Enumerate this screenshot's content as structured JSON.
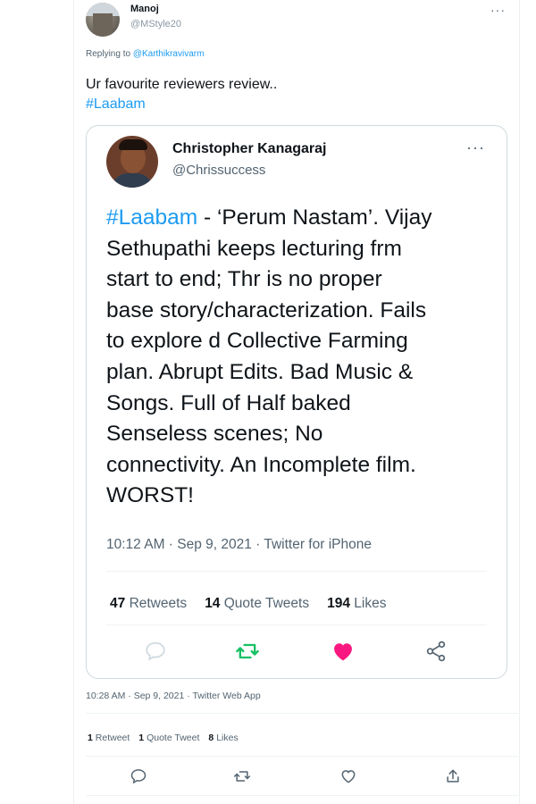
{
  "outer_tweet": {
    "author_name": "Manoj",
    "author_handle": "@MStyle20",
    "more_icon": "more-dots-icon",
    "replying_prefix": "Replying to",
    "replying_handle": "@Karthikravivarm",
    "text": "Ur favourite reviewers review..",
    "hashtag": "#Laabam",
    "meta": "10:28 AM · Sep 9, 2021 · Twitter Web App",
    "stats": {
      "retweets_count": "1",
      "retweets_label": "Retweet",
      "quotes_count": "1",
      "quotes_label": "Quote Tweet",
      "likes_count": "8",
      "likes_label": "Likes"
    },
    "actions": [
      "reply-icon",
      "retweet-icon",
      "like-icon",
      "share-icon"
    ]
  },
  "quoted_tweet": {
    "author_name": "Christopher Kanagaraj",
    "author_handle": "@Chrissuccess",
    "more_icon": "more-dots-icon",
    "text_lines": {
      "l1_hashtag": "#Laabam",
      "l1_rest": " - ‘Perum Nastam’. Vijay",
      "l2": "Sethupathi keeps lecturing frm",
      "l3": "start to end; Thr is no proper",
      "l4": "base story/characterization. Fails",
      "l5": "to explore d Collective Farming",
      "l6": "plan. Abrupt Edits. Bad Music &",
      "l7": "Songs. Full of Half baked",
      "l8": "Senseless scenes; No",
      "l9": "connectivity. An Incomplete film.",
      "l10": "WORST!"
    },
    "meta": "10:12 AM · Sep 9, 2021 · Twitter for iPhone",
    "stats": {
      "retweets_count": "47",
      "retweets_label": "Retweets",
      "quotes_count": "14",
      "quotes_label": "Quote Tweets",
      "likes_count": "194",
      "likes_label": "Likes"
    },
    "colors": {
      "retweet": "#17bf63",
      "like": "#f91880",
      "link": "#1d9bf0"
    },
    "actions": [
      "reply-icon",
      "retweet-icon",
      "like-icon-filled",
      "share-icon"
    ]
  }
}
